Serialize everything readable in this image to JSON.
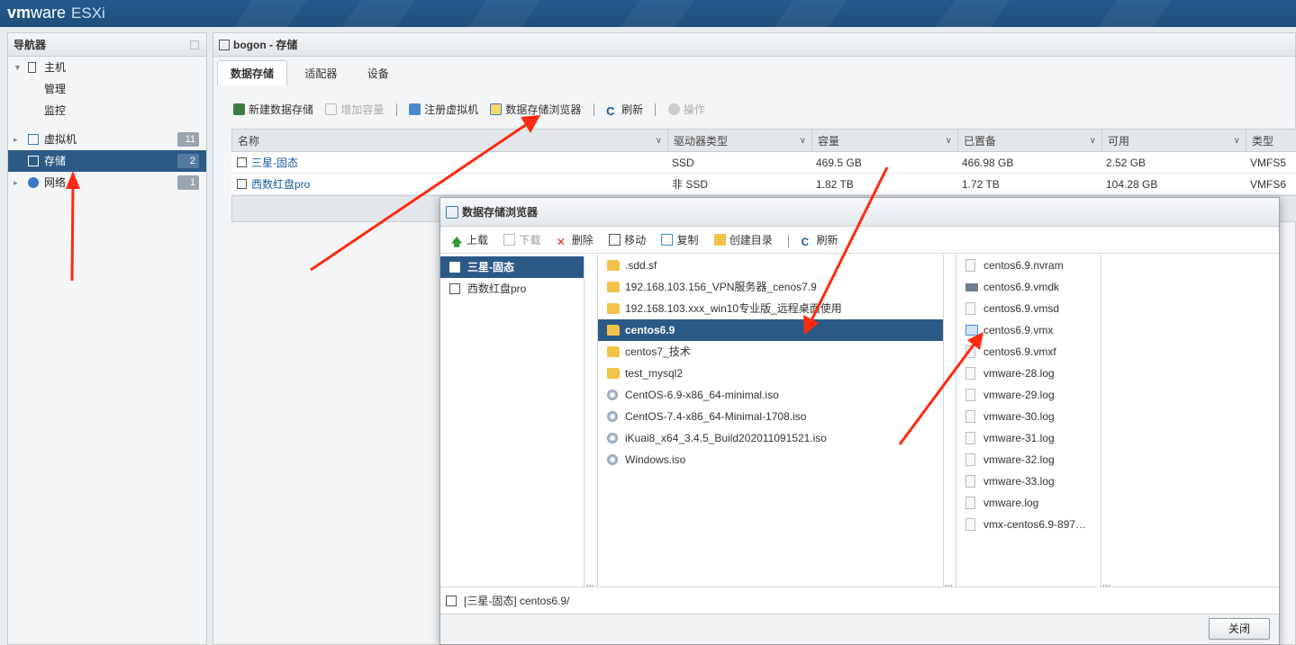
{
  "brand": {
    "vm": "vm",
    "ware": "ware",
    "product": "ESXi"
  },
  "navigator": {
    "title": "导航器",
    "items": [
      {
        "label": "主机",
        "icon": "host-icon"
      },
      {
        "label": "管理"
      },
      {
        "label": "监控"
      },
      {
        "label": "虚拟机",
        "count": "11",
        "icon": "vm-icon"
      },
      {
        "label": "存储",
        "count": "2",
        "icon": "storage-icon"
      },
      {
        "label": "网络",
        "count": "1",
        "icon": "network-icon"
      }
    ]
  },
  "main": {
    "title": "bogon - 存储",
    "tabs": [
      "数据存储",
      "适配器",
      "设备"
    ],
    "toolbar": {
      "new_datastore": "新建数据存储",
      "increase": "增加容量",
      "register_vm": "注册虚拟机",
      "browser": "数据存储浏览器",
      "refresh": "刷新",
      "actions": "操作"
    },
    "columns": [
      "名称",
      "驱动器类型",
      "容量",
      "已置备",
      "可用",
      "类型"
    ],
    "rows": [
      {
        "name": "三星-固态",
        "drive": "SSD",
        "capacity": "469.5 GB",
        "provisioned": "466.98 GB",
        "free": "2.52 GB",
        "type": "VMFS5"
      },
      {
        "name": "西数红盘pro",
        "drive": "非 SSD",
        "capacity": "1.82 TB",
        "provisioned": "1.72 TB",
        "free": "104.28 GB",
        "type": "VMFS6"
      }
    ]
  },
  "dialog": {
    "title": "数据存储浏览器",
    "tools": [
      "上载",
      "下载",
      "删除",
      "移动",
      "复制",
      "创建目录",
      "刷新"
    ],
    "datastores": [
      "三星-固态",
      "西数红盘pro"
    ],
    "folder_items": [
      {
        "label": ".sdd.sf",
        "kind": "folder"
      },
      {
        "label": "192.168.103.156_VPN服务器_cenos7.9",
        "kind": "folder"
      },
      {
        "label": "192.168.103.xxx_win10专业版_远程桌面使用",
        "kind": "folder"
      },
      {
        "label": "centos6.9",
        "kind": "folder"
      },
      {
        "label": "centos7_技术",
        "kind": "folder"
      },
      {
        "label": "test_mysql2",
        "kind": "folder"
      },
      {
        "label": "CentOS-6.9-x86_64-minimal.iso",
        "kind": "iso"
      },
      {
        "label": "CentOS-7.4-x86_64-Minimal-1708.iso",
        "kind": "iso"
      },
      {
        "label": "iKuai8_x64_3.4.5_Build202011091521.iso",
        "kind": "iso"
      },
      {
        "label": "Windows.iso",
        "kind": "iso"
      }
    ],
    "files": [
      {
        "label": "centos6.9.nvram",
        "kind": "file"
      },
      {
        "label": "centos6.9.vmdk",
        "kind": "disk"
      },
      {
        "label": "centos6.9.vmsd",
        "kind": "file"
      },
      {
        "label": "centos6.9.vmx",
        "kind": "vmx"
      },
      {
        "label": "centos6.9.vmxf",
        "kind": "file"
      },
      {
        "label": "vmware-28.log",
        "kind": "file"
      },
      {
        "label": "vmware-29.log",
        "kind": "file"
      },
      {
        "label": "vmware-30.log",
        "kind": "file"
      },
      {
        "label": "vmware-31.log",
        "kind": "file"
      },
      {
        "label": "vmware-32.log",
        "kind": "file"
      },
      {
        "label": "vmware-33.log",
        "kind": "file"
      },
      {
        "label": "vmware.log",
        "kind": "file"
      },
      {
        "label": "vmx-centos6.9-897…",
        "kind": "file"
      }
    ],
    "path": "[三星-固态] centos6.9/",
    "close": "关闭"
  },
  "colors": {
    "header": "#235a8d",
    "selection": "#2c5a87",
    "annotation": "#ff2a10"
  }
}
